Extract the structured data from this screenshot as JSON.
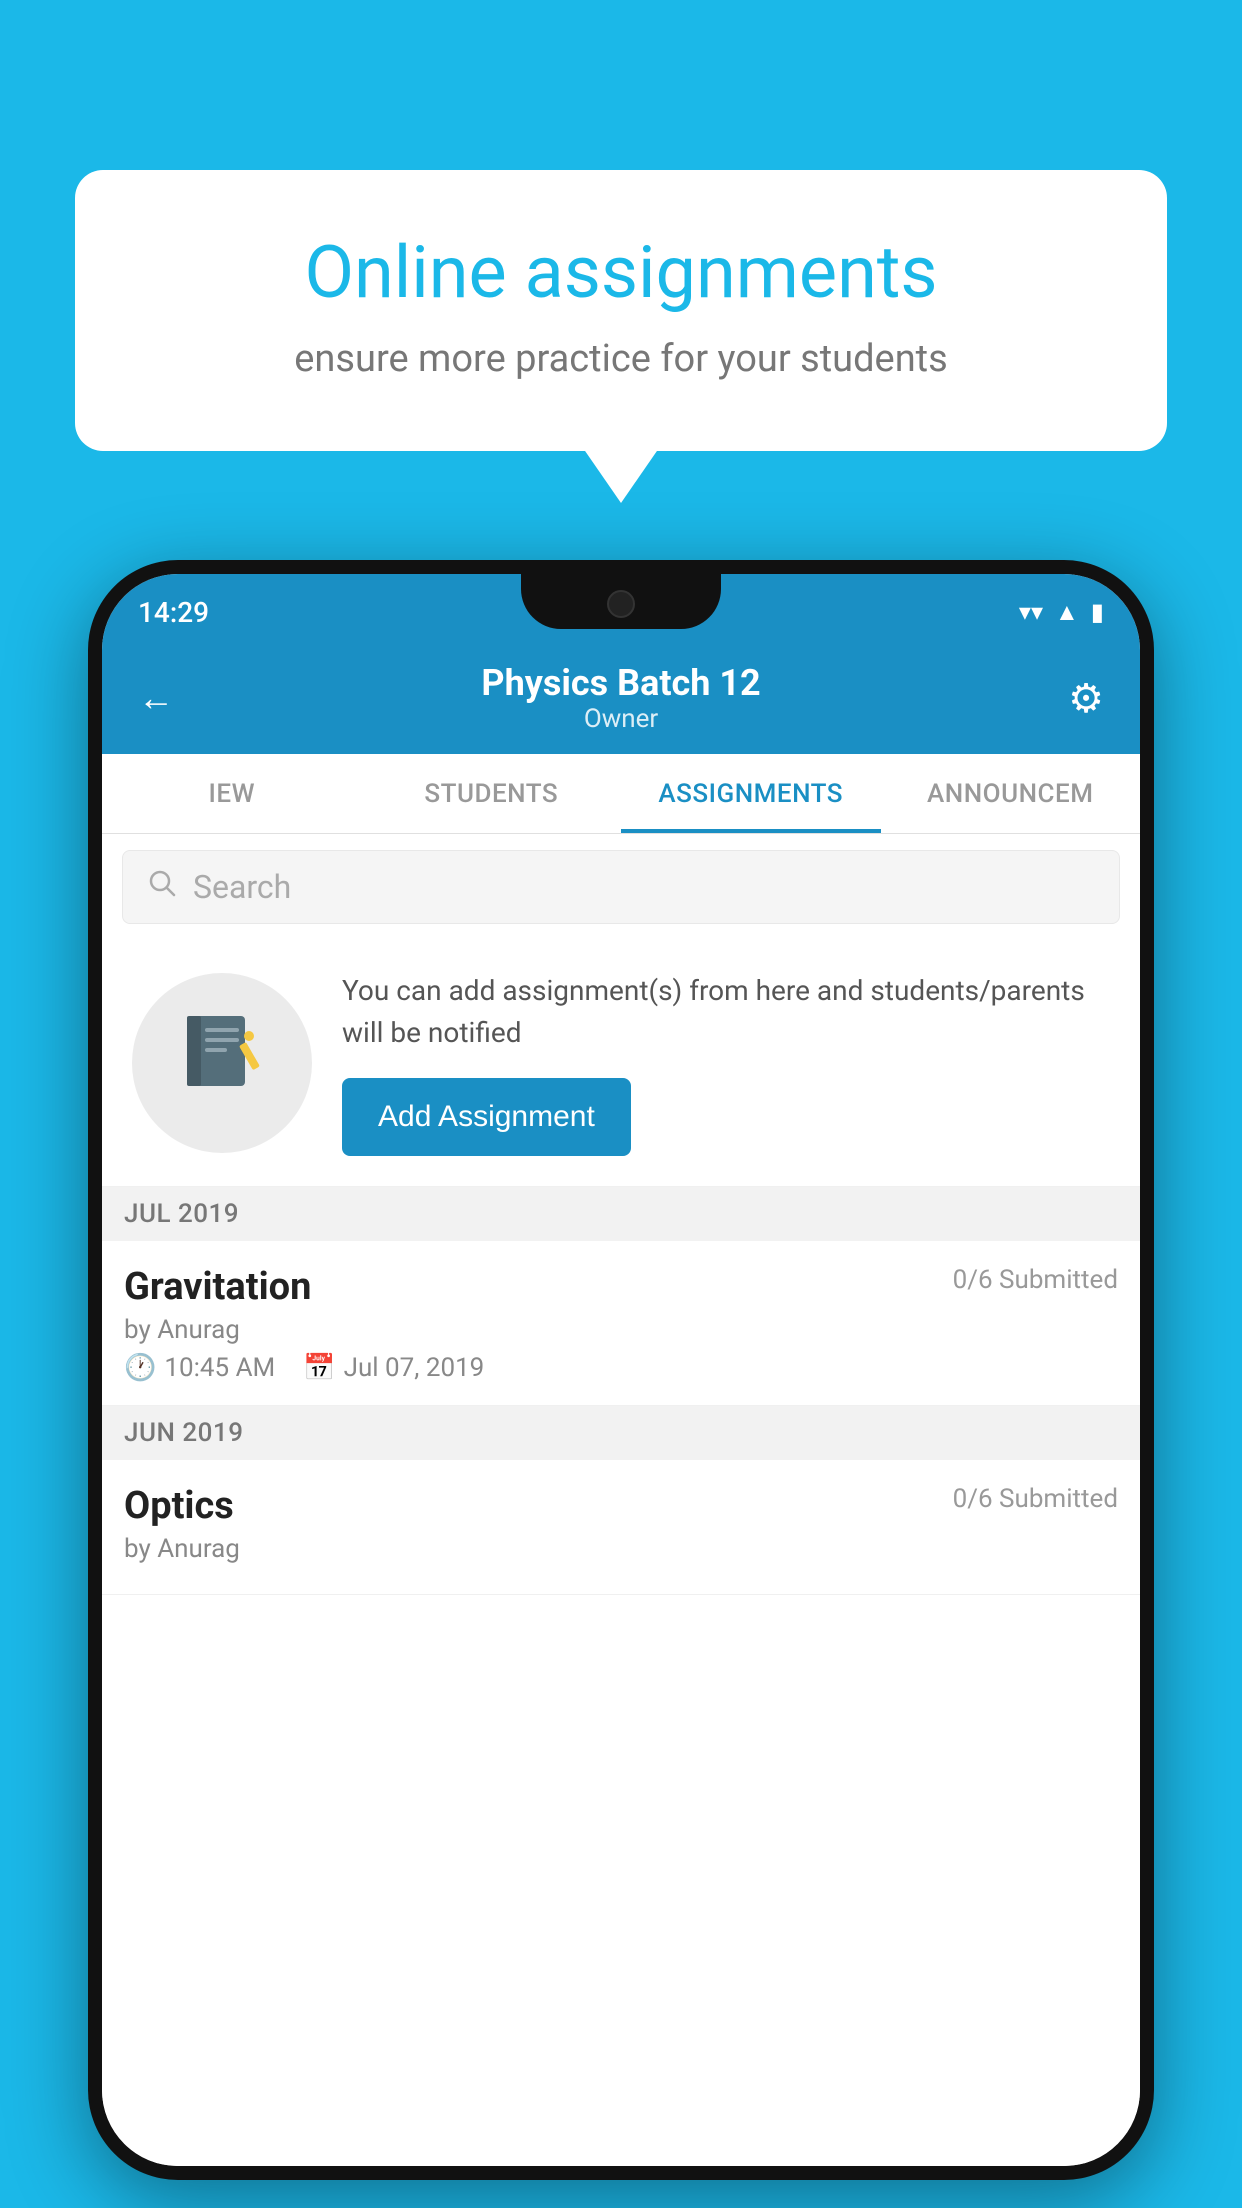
{
  "background": {
    "color": "#1bb8e8"
  },
  "speech_bubble": {
    "title": "Online assignments",
    "subtitle": "ensure more practice for your students"
  },
  "phone": {
    "status_bar": {
      "time": "14:29",
      "wifi_icon": "wifi",
      "signal_icon": "signal",
      "battery_icon": "battery"
    },
    "header": {
      "title": "Physics Batch 12",
      "subtitle": "Owner",
      "back_label": "←",
      "settings_label": "⚙"
    },
    "tabs": [
      {
        "label": "IEW",
        "active": false
      },
      {
        "label": "STUDENTS",
        "active": false
      },
      {
        "label": "ASSIGNMENTS",
        "active": true
      },
      {
        "label": "ANNOUNCEM",
        "active": false
      }
    ],
    "search": {
      "placeholder": "Search"
    },
    "empty_state": {
      "description": "You can add assignment(s) from here and students/parents will be notified",
      "add_button": "Add Assignment"
    },
    "month_sections": [
      {
        "label": "JUL 2019",
        "assignments": [
          {
            "name": "Gravitation",
            "submitted": "0/6 Submitted",
            "by": "by Anurag",
            "time": "10:45 AM",
            "date": "Jul 07, 2019"
          }
        ]
      },
      {
        "label": "JUN 2019",
        "assignments": [
          {
            "name": "Optics",
            "submitted": "0/6 Submitted",
            "by": "by Anurag",
            "time": "",
            "date": ""
          }
        ]
      }
    ]
  }
}
